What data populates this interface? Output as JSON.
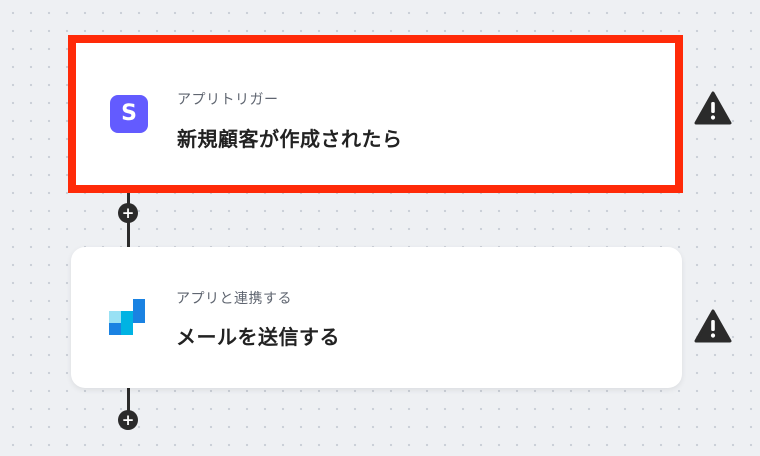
{
  "flow": {
    "steps": [
      {
        "subtitle": "アプリトリガー",
        "title": "新規顧客が作成されたら",
        "icon": "stripe-icon",
        "icon_letter": "S",
        "icon_color": "#635bff",
        "highlighted": true,
        "highlight_color": "#ff2a08"
      },
      {
        "subtitle": "アプリと連携する",
        "title": "メールを送信する",
        "icon": "sendgrid-icon",
        "icon_colors": [
          "#1a82e2",
          "#00b3e3",
          "#99e1f4"
        ],
        "highlighted": false
      }
    ],
    "add_step_symbol": "+",
    "warning_symbol": "!"
  }
}
